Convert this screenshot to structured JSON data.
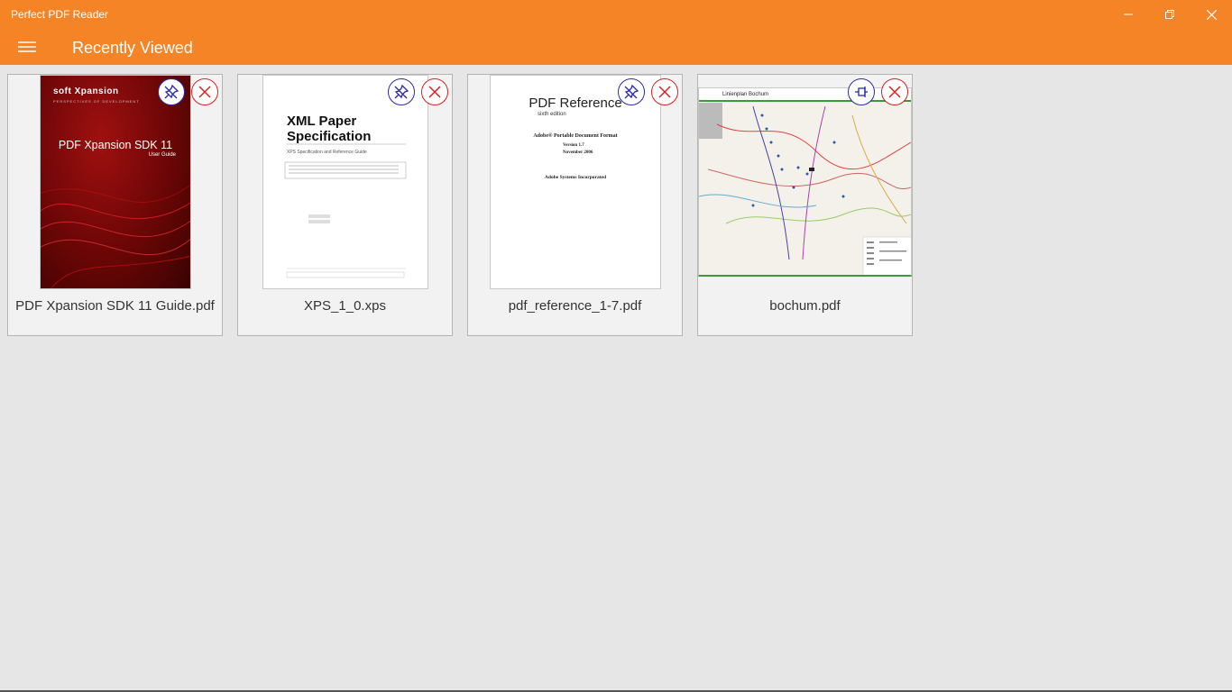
{
  "window": {
    "title": "Perfect PDF Reader",
    "accent_color": "#f58426",
    "controls": [
      "minimize",
      "restore",
      "close"
    ]
  },
  "appbar": {
    "menu_icon": "hamburger-icon",
    "title": "Recently Viewed"
  },
  "recent_files": [
    {
      "name": "PDF Xpansion SDK 11 Guide.pdf",
      "pin_icon": "pin-icon",
      "remove_icon": "close-circle-icon",
      "thumbnail": {
        "brand": "soft Xpansion",
        "brand_tagline": "PERSPECTIVES OF DEVELOPMENT",
        "title": "PDF Xpansion SDK 11",
        "subtitle": "User Guide"
      }
    },
    {
      "name": "XPS_1_0.xps",
      "pin_icon": "pin-icon",
      "remove_icon": "close-circle-icon",
      "thumbnail": {
        "title_line1": "XML Paper",
        "title_line2": "Specification",
        "subtitle": "XPS Specification and Reference Guide"
      }
    },
    {
      "name": "pdf_reference_1-7.pdf",
      "pin_icon": "pin-icon",
      "remove_icon": "close-circle-icon",
      "thumbnail": {
        "title": "PDF Reference",
        "edition": "sixth edition",
        "subtitle": "Adobe® Portable Document Format",
        "version": "Version 1.7",
        "date": "November 2006",
        "publisher": "Adobe Systems Incorporated"
      }
    },
    {
      "name": "bochum.pdf",
      "pin_icon": "pinned-icon",
      "remove_icon": "close-circle-icon",
      "thumbnail": {
        "header": "Linienplan Bochum"
      }
    }
  ]
}
